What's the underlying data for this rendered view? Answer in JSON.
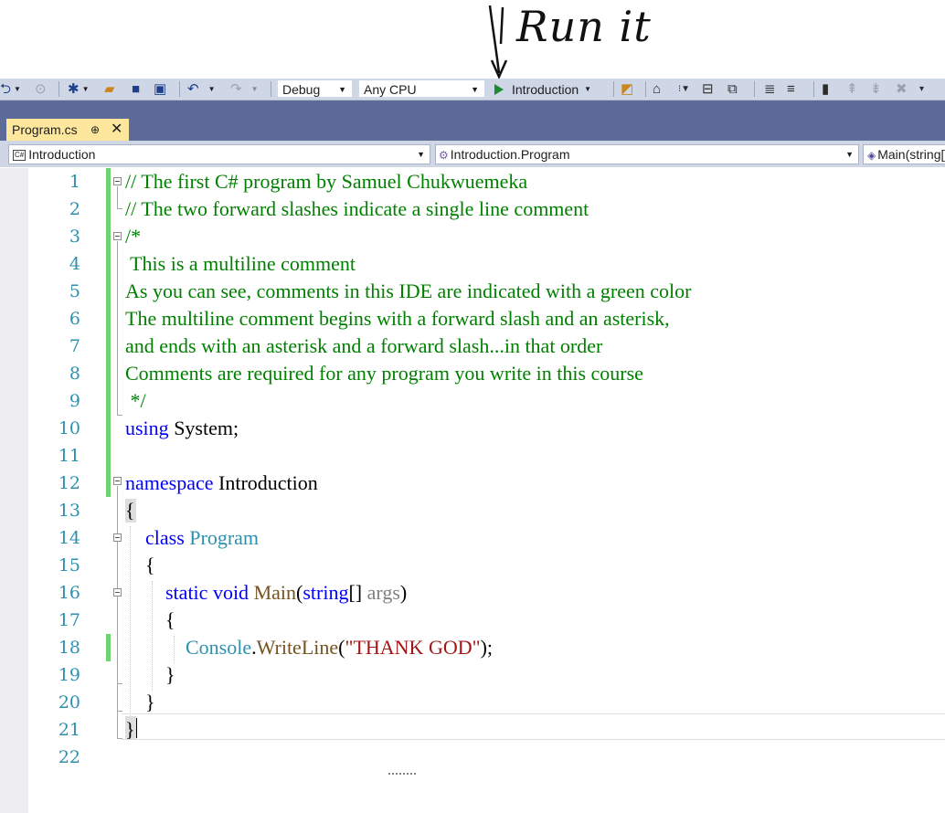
{
  "annotation": {
    "text": "Run it"
  },
  "toolbar": {
    "config": "Debug",
    "platform": "Any CPU",
    "start_target": "Introduction"
  },
  "tab": {
    "title": "Program.cs",
    "pin": "⊕",
    "close": "✕"
  },
  "navbar": {
    "project": "Introduction",
    "type": "Introduction.Program",
    "member": "Main(string[] args)",
    "cs_badge": "C#"
  },
  "editor": {
    "line_numbers": [
      "1",
      "2",
      "3",
      "4",
      "5",
      "6",
      "7",
      "8",
      "9",
      "10",
      "11",
      "12",
      "13",
      "14",
      "15",
      "16",
      "17",
      "18",
      "19",
      "20",
      "21",
      "22"
    ],
    "lines": [
      [
        [
          "cmt",
          "// The first C# program by Samuel Chukwuemeka"
        ]
      ],
      [
        [
          "cmt",
          "// The two forward slashes indicate a single line comment"
        ]
      ],
      [
        [
          "cmt",
          "/*"
        ]
      ],
      [
        [
          "cmt",
          " This is a multiline comment"
        ]
      ],
      [
        [
          "cmt",
          "As you can see, comments in this IDE are indicated with a green color"
        ]
      ],
      [
        [
          "cmt",
          "The multiline comment begins with a forward slash and an asterisk,"
        ]
      ],
      [
        [
          "cmt",
          "and ends with an asterisk and a forward slash...in that order"
        ]
      ],
      [
        [
          "cmt",
          "Comments are required for any program you write in this course"
        ]
      ],
      [
        [
          "cmt",
          " */"
        ]
      ],
      [
        [
          "kw",
          "using"
        ],
        [
          "plain",
          " System;"
        ]
      ],
      [],
      [
        [
          "kw",
          "namespace"
        ],
        [
          "plain",
          " Introduction"
        ]
      ],
      [
        [
          "plain",
          "{"
        ]
      ],
      [
        [
          "plain",
          "    "
        ],
        [
          "kw",
          "class"
        ],
        [
          "plain",
          " "
        ],
        [
          "type",
          "Program"
        ]
      ],
      [
        [
          "plain",
          "    {"
        ]
      ],
      [
        [
          "plain",
          "        "
        ],
        [
          "kw",
          "static"
        ],
        [
          "plain",
          " "
        ],
        [
          "kw",
          "void"
        ],
        [
          "plain",
          " "
        ],
        [
          "meth",
          "Main"
        ],
        [
          "plain",
          "("
        ],
        [
          "kw",
          "string"
        ],
        [
          "plain",
          "[] "
        ],
        [
          "unused",
          "args"
        ],
        [
          "plain",
          ")"
        ]
      ],
      [
        [
          "plain",
          "        {"
        ]
      ],
      [
        [
          "plain",
          "            "
        ],
        [
          "type",
          "Console"
        ],
        [
          "plain",
          "."
        ],
        [
          "meth",
          "WriteLine"
        ],
        [
          "plain",
          "("
        ],
        [
          "str",
          "\"THANK GOD\""
        ],
        [
          "plain",
          ");"
        ]
      ],
      [
        [
          "plain",
          "        }"
        ]
      ],
      [
        [
          "plain",
          "    }"
        ]
      ],
      [
        [
          "plain",
          "}"
        ]
      ],
      []
    ]
  },
  "colors": {
    "comment": "#008000",
    "keyword": "#0000ff",
    "type": "#2b91af",
    "string": "#a31515",
    "method": "#74531f",
    "line_number": "#2b91af",
    "change_bar": "#6fd36f",
    "tab_active": "#fde79c",
    "band": "#5d6b99"
  }
}
